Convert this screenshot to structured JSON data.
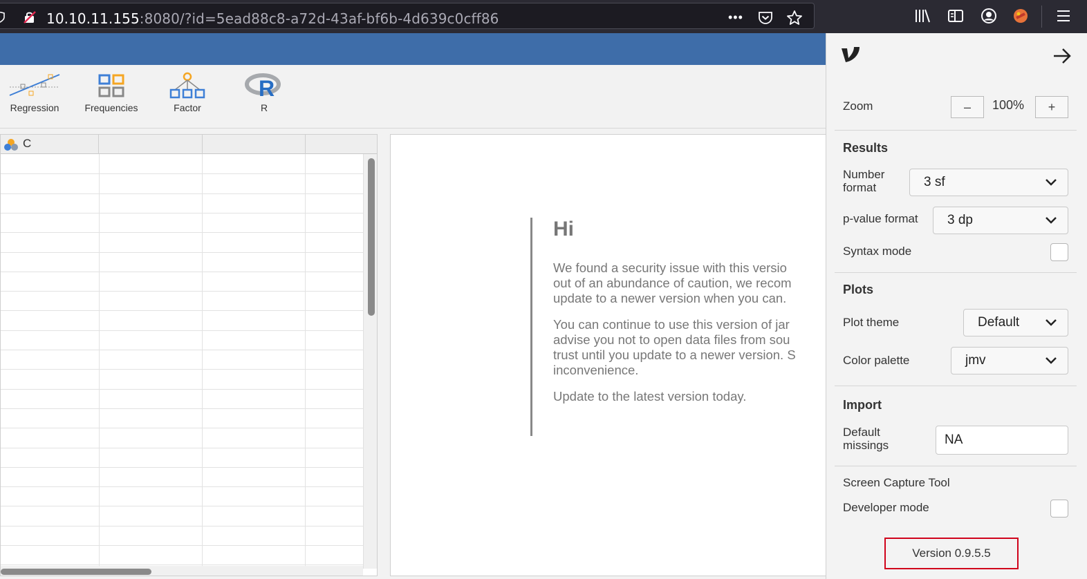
{
  "browser": {
    "url_host": "10.10.11.155",
    "url_rest": ":8080/?id=5ead88c8-a72d-43af-bf6b-4d639c0cff86",
    "more_glyph": "•••",
    "icons": [
      "shield-icon",
      "insecure-connection-icon",
      "pocket-icon",
      "bookmark-star-icon",
      "library-icon",
      "reader-view-icon",
      "account-icon",
      "extension-icon",
      "menu-icon"
    ]
  },
  "ribbon": {
    "buttons": [
      {
        "label": "Regression"
      },
      {
        "label": "Frequencies"
      },
      {
        "label": "Factor"
      },
      {
        "label": "R"
      }
    ]
  },
  "spreadsheet": {
    "columns": [
      {
        "label": "C"
      },
      {
        "label": ""
      },
      {
        "label": ""
      },
      {
        "label": ""
      }
    ]
  },
  "notice": {
    "title": "Hi",
    "paragraphs": [
      "We found a security issue with this versio\nout of an abundance of caution, we recom\nupdate to a newer version when you can.",
      "You can continue to use this version of jar\nadvise you not to open data files from sou\ntrust until you update to a newer version. S\ninconvenience.",
      "Update to the latest version today."
    ]
  },
  "settings": {
    "logo_glyph": "ν",
    "zoom": {
      "label": "Zoom",
      "minus": "–",
      "value": "100%",
      "plus": "+"
    },
    "results": {
      "title": "Results",
      "number_format_label": "Number\nformat",
      "number_format_value": "3 sf",
      "pvalue_format_label": "p-value format",
      "pvalue_format_value": "3 dp",
      "syntax_mode_label": "Syntax mode"
    },
    "plots": {
      "title": "Plots",
      "plot_theme_label": "Plot theme",
      "plot_theme_value": "Default",
      "color_palette_label": "Color palette",
      "color_palette_value": "jmv"
    },
    "import": {
      "title": "Import",
      "default_missings_label": "Default\nmissings",
      "default_missings_value": "NA"
    },
    "screen_capture_label": "Screen Capture Tool",
    "developer_mode_label": "Developer mode",
    "version": "Version 0.9.5.5"
  },
  "colors": {
    "header_blue": "#3e6da9",
    "browser_bg": "#2b2a33",
    "highlight_red": "#d0021b",
    "icon_blue": "#3e7fd6",
    "icon_orange": "#f5a623"
  }
}
